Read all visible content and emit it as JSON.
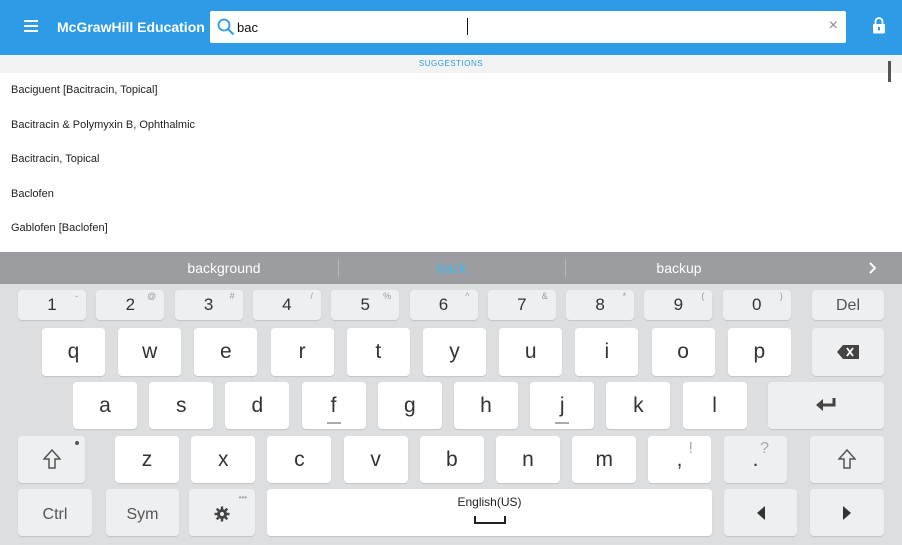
{
  "app": {
    "brand": "McGrawHill Education",
    "search_value": "bac",
    "clear_symbol": "×",
    "icons": {
      "menu": "hamburger-menu-icon",
      "search": "search-icon",
      "clear": "close-icon",
      "lock": "lock-icon"
    },
    "accent_color": "#2d9be6"
  },
  "suggestions": {
    "header": "SUGGESTIONS",
    "items": [
      "Baciguent [Bacitracin, Topical]",
      "Bacitracin & Polymyxin B, Ophthalmic",
      "Bacitracin, Topical",
      "Baclofen",
      "Gablofen [Baclofen]"
    ]
  },
  "keyboard": {
    "predictions": [
      "background",
      "back",
      "backup"
    ],
    "active_prediction": "back",
    "number_row": [
      {
        "key": "1",
        "alt": "-"
      },
      {
        "key": "2",
        "alt": "@"
      },
      {
        "key": "3",
        "alt": "#"
      },
      {
        "key": "4",
        "alt": "/"
      },
      {
        "key": "5",
        "alt": "%"
      },
      {
        "key": "6",
        "alt": "^"
      },
      {
        "key": "7",
        "alt": "&"
      },
      {
        "key": "8",
        "alt": "*"
      },
      {
        "key": "9",
        "alt": "("
      },
      {
        "key": "0",
        "alt": ")"
      }
    ],
    "del": "Del",
    "row1": [
      "q",
      "w",
      "e",
      "r",
      "t",
      "y",
      "u",
      "i",
      "o",
      "p"
    ],
    "row2": [
      "a",
      "s",
      "d",
      "f",
      "g",
      "h",
      "j",
      "k",
      "l"
    ],
    "row3": [
      "z",
      "x",
      "c",
      "v",
      "b",
      "n",
      "m"
    ],
    "comma": ",",
    "comma_alt": "!",
    "period": ".",
    "period_alt": "?",
    "ctrl": "Ctrl",
    "sym": "Sym",
    "settings_alt": "•••",
    "space_label": "English(US)"
  }
}
